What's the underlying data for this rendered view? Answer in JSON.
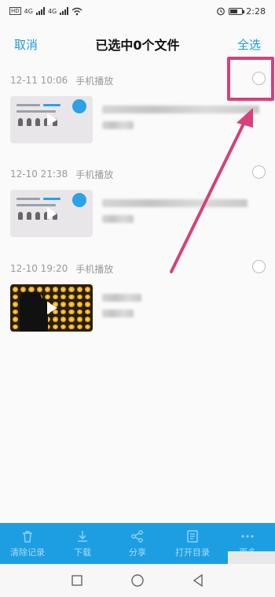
{
  "status_bar": {
    "hd1": "HD",
    "hd2": "HD",
    "net1": "4G",
    "net2": "4G",
    "time": "2:28",
    "battery_level": 0.55
  },
  "header": {
    "cancel_label": "取消",
    "title": "已选中0个文件",
    "select_all_label": "全选"
  },
  "groups": [
    {
      "date": "12-11 10:06",
      "source": "手机播放",
      "thumb": "slide"
    },
    {
      "date": "12-10 21:38",
      "source": "手机播放",
      "thumb": "slide"
    },
    {
      "date": "12-10 19:20",
      "source": "手机播放",
      "thumb": "concert"
    }
  ],
  "toolbar": {
    "items": [
      {
        "label": "清除记录",
        "icon": "trash-icon"
      },
      {
        "label": "下载",
        "icon": "download-icon"
      },
      {
        "label": "分享",
        "icon": "share-icon"
      },
      {
        "label": "打开目录",
        "icon": "folder-doc-icon"
      },
      {
        "label": "更多",
        "icon": "more-icon"
      }
    ]
  },
  "colors": {
    "accent": "#1f9bd8",
    "toolbar_bg": "#1d9ee2",
    "annotation": "#d7407a"
  }
}
